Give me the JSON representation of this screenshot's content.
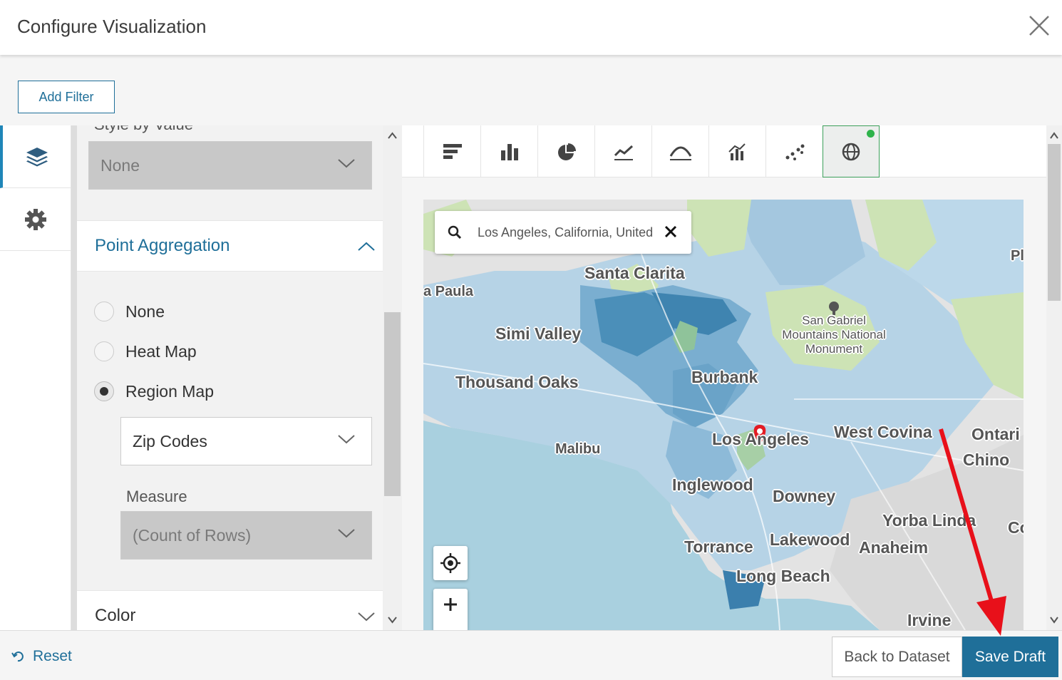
{
  "header": {
    "title": "Configure Visualization",
    "close_icon": "close-icon"
  },
  "filter_bar": {
    "add_filter_label": "Add Filter"
  },
  "left_nav": {
    "items": [
      {
        "icon": "layers-icon",
        "active": true
      },
      {
        "icon": "gear-icon",
        "active": false
      }
    ]
  },
  "panel": {
    "style_by_value_label": "Style by Value",
    "style_by_value_selected": "None",
    "point_aggregation": {
      "title": "Point Aggregation",
      "options": [
        "None",
        "Heat Map",
        "Region Map"
      ],
      "selected": "Region Map",
      "region_select_value": "Zip Codes",
      "measure_label": "Measure",
      "measure_value": "(Count of Rows)"
    },
    "color_section_title": "Color"
  },
  "viz_toolbar": {
    "types": [
      "bar-horizontal-icon",
      "column-chart-icon",
      "pie-chart-icon",
      "line-chart-icon",
      "area-chart-icon",
      "combo-chart-icon",
      "scatter-plot-icon",
      "map-globe-icon"
    ],
    "selected": "map-globe-icon",
    "accent": "#3ca05a"
  },
  "map": {
    "search_value": "Los Angeles, California, United",
    "labels": {
      "santa_clarita": "Santa Clarita",
      "paula": "a Paula",
      "simi_valley": "Simi Valley",
      "san_gabriel_1": "San Gabriel",
      "san_gabriel_2": "Mountains National",
      "san_gabriel_3": "Monument",
      "thousand_oaks": "Thousand Oaks",
      "burbank": "Burbank",
      "los_angeles": "Los Angeles",
      "west_covina": "West Covina",
      "ontario": "Ontari",
      "chino": "Chino",
      "malibu": "Malibu",
      "inglewood": "Inglewood",
      "downey": "Downey",
      "yorba_linda": "Yorba Linda",
      "co": "Co",
      "torrance": "Torrance",
      "lakewood": "Lakewood",
      "anaheim": "Anaheim",
      "long_beach": "Long Beach",
      "irvine": "Irvine",
      "pl": "Pl"
    }
  },
  "footer": {
    "reset_label": "Reset",
    "back_label": "Back to Dataset",
    "save_label": "Save Draft"
  },
  "colors": {
    "primary": "#1f6f99",
    "arrow": "#e8101a"
  }
}
